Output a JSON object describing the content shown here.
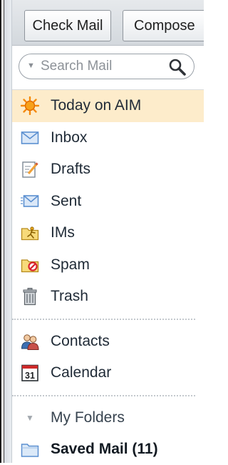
{
  "toolbar": {
    "check_mail_label": "Check Mail",
    "compose_label": "Compose"
  },
  "search": {
    "placeholder": "Search Mail",
    "icon": "magnifier-icon"
  },
  "nav": {
    "items": [
      {
        "label": "Today on AIM",
        "icon": "sun-icon",
        "selected": true
      },
      {
        "label": "Inbox",
        "icon": "envelope-icon"
      },
      {
        "label": "Drafts",
        "icon": "draft-pencil-icon"
      },
      {
        "label": "Sent",
        "icon": "sent-envelope-icon"
      },
      {
        "label": "IMs",
        "icon": "im-folder-icon"
      },
      {
        "label": "Spam",
        "icon": "spam-folder-icon"
      },
      {
        "label": "Trash",
        "icon": "trash-can-icon"
      }
    ],
    "tools": [
      {
        "label": "Contacts",
        "icon": "contacts-icon"
      },
      {
        "label": "Calendar",
        "icon": "calendar-icon",
        "icon_text": "31"
      }
    ]
  },
  "folders": {
    "header": "My Folders",
    "items": [
      {
        "label": "Saved Mail (11)",
        "icon": "folder-icon"
      }
    ]
  },
  "colors": {
    "selected_background": "#fdeccb",
    "accent_blue": "#5b8fd0",
    "sun_orange": "#f58a0b"
  }
}
